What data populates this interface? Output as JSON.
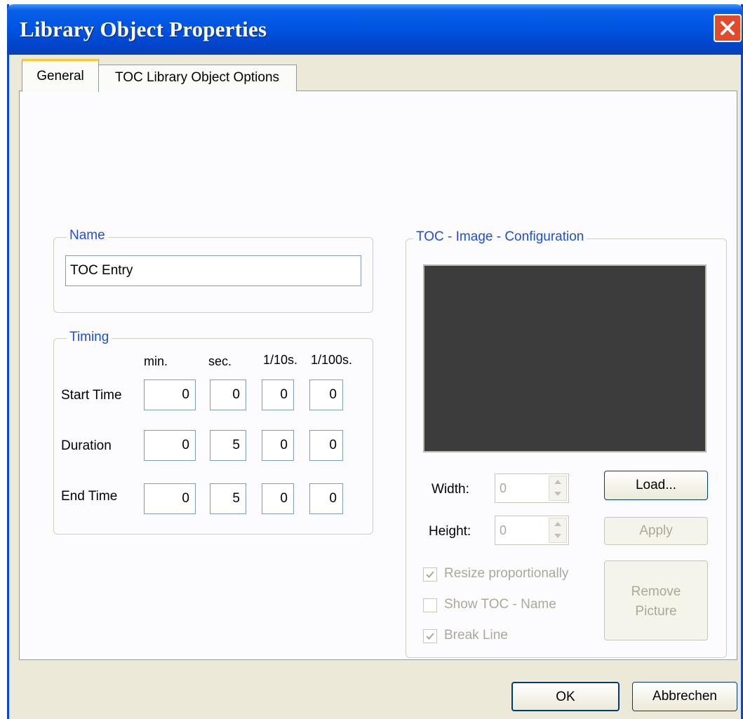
{
  "window": {
    "title": "Library Object Properties"
  },
  "tabs": [
    {
      "label": "General",
      "active": true
    },
    {
      "label": "TOC Library Object Options",
      "active": false
    }
  ],
  "name_group": {
    "legend": "Name",
    "value": "TOC Entry"
  },
  "timing": {
    "legend": "Timing",
    "columns": [
      "min.",
      "sec.",
      "1/10s.",
      "1/100s."
    ],
    "rows": [
      {
        "label": "Start Time",
        "values": [
          "0",
          "0",
          "0",
          "0"
        ]
      },
      {
        "label": "Duration",
        "values": [
          "0",
          "5",
          "0",
          "0"
        ]
      },
      {
        "label": "End Time",
        "values": [
          "0",
          "5",
          "0",
          "0"
        ]
      }
    ]
  },
  "image_config": {
    "legend": "TOC - Image - Configuration",
    "width_label": "Width:",
    "width_value": "0",
    "height_label": "Height:",
    "height_value": "0",
    "load_label": "Load...",
    "apply_label": "Apply",
    "remove_line1": "Remove",
    "remove_line2": "Picture",
    "checkboxes": [
      {
        "label": "Resize proportionally",
        "checked": true
      },
      {
        "label": "Show TOC - Name",
        "checked": false
      },
      {
        "label": "Break Line",
        "checked": true
      }
    ]
  },
  "footer": {
    "ok_label": "OK",
    "cancel_label": "Abbrechen"
  },
  "colors": {
    "titlebar": "#0054e3",
    "close": "#e24a2c",
    "legend": "#1f4fd6",
    "tab_highlight": "#ffc83c",
    "preview": "#3c3c3c"
  }
}
